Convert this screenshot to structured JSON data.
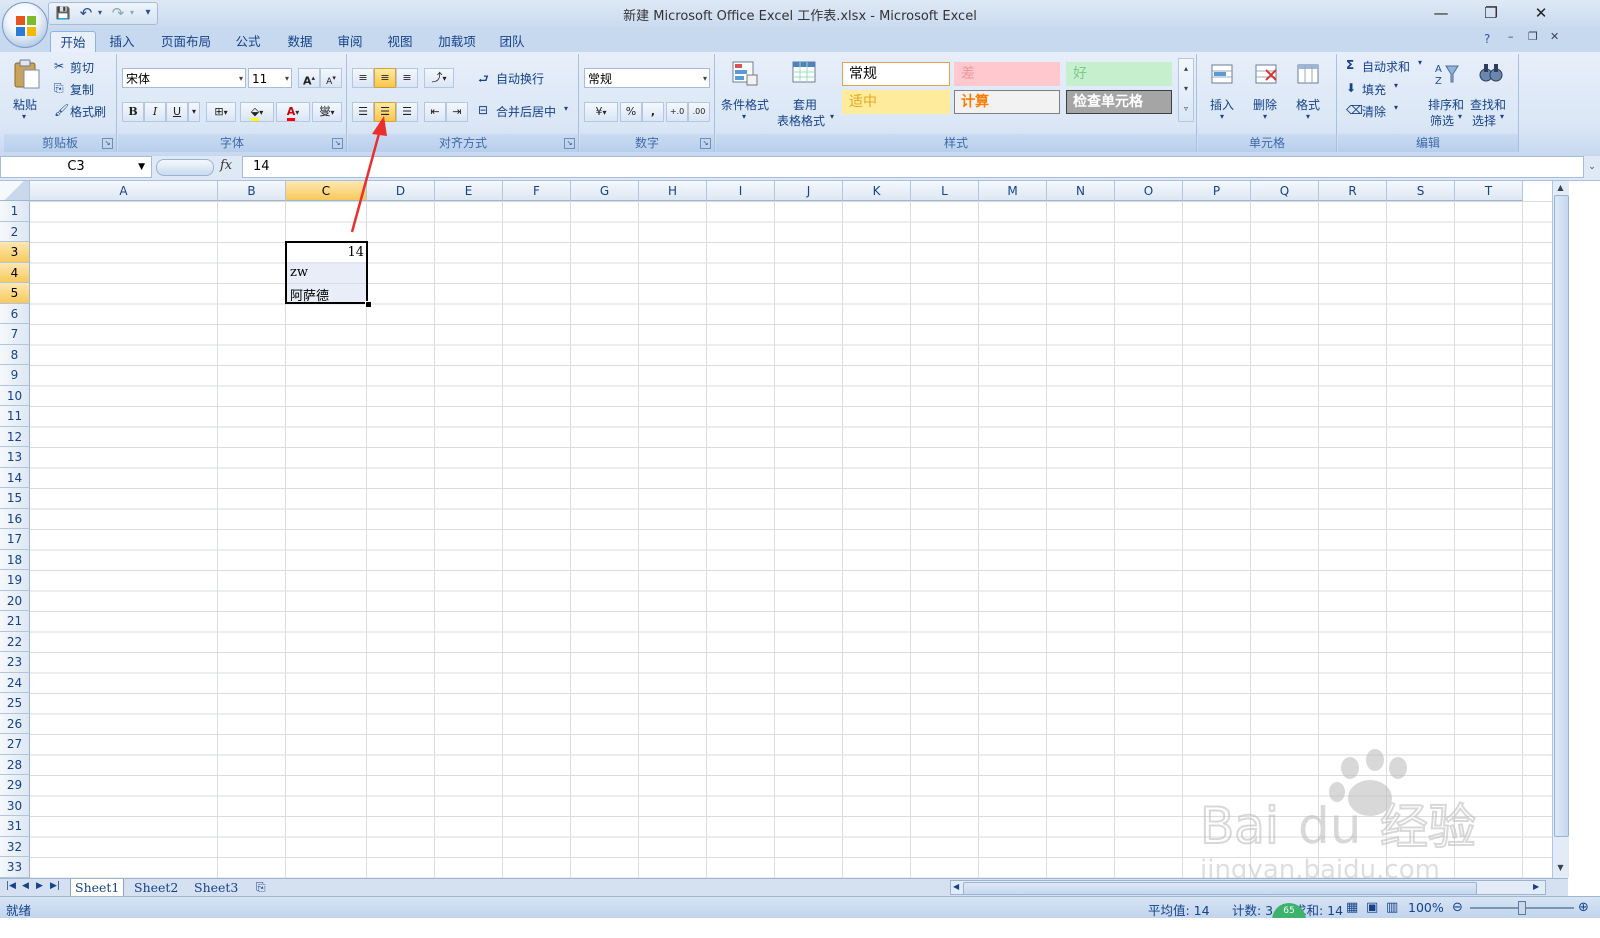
{
  "window": {
    "title": "新建 Microsoft Office Excel 工作表.xlsx - Microsoft Excel",
    "controls": [
      "—",
      "❐",
      "✕"
    ]
  },
  "quick_access": {
    "save": "💾",
    "undo": "↶",
    "redo": "↷",
    "customize": "▾"
  },
  "tabs": [
    "开始",
    "插入",
    "页面布局",
    "公式",
    "数据",
    "审阅",
    "视图",
    "加载项",
    "团队"
  ],
  "active_tab": "开始",
  "ribbon": {
    "clipboard": {
      "label": "剪贴板",
      "paste": "粘贴",
      "cut": "剪切",
      "copy": "复制",
      "format_painter": "格式刷"
    },
    "font": {
      "label": "字体",
      "font_name": "宋体",
      "font_size": "11",
      "grow": "A",
      "shrink": "A",
      "bold": "B",
      "italic": "I",
      "underline": "U",
      "phonetic": "燮"
    },
    "alignment": {
      "label": "对齐方式",
      "wrap_text": "自动换行",
      "merge_center": "合并后居中"
    },
    "number": {
      "label": "数字",
      "format": "常规",
      "currency": "¥",
      "percent": "%",
      "comma": ",",
      "inc_decimal": "+.0",
      "dec_decimal": ".00"
    },
    "styles": {
      "label": "样式",
      "conditional": "条件格式",
      "table_format_1": "套用",
      "table_format_2": "表格格式",
      "cells": [
        {
          "text": "常规",
          "bg": "#ffffff",
          "color": "#000000",
          "border": "#e8a050"
        },
        {
          "text": "差",
          "bg": "#ffc7ce",
          "color": "#ea9aa0",
          "border": "#ffc7ce"
        },
        {
          "text": "好",
          "bg": "#c6efce",
          "color": "#7fc98a",
          "border": "#c6efce"
        },
        {
          "text": "适中",
          "bg": "#ffeb9c",
          "color": "#e4a81b",
          "border": "#ffeb9c"
        },
        {
          "text": "计算",
          "bg": "#f2f2f2",
          "color": "#fa7d00",
          "border": "#7f7f7f"
        },
        {
          "text": "检查单元格",
          "bg": "#a5a5a5",
          "color": "#ffffff",
          "border": "#3f3f3f"
        }
      ]
    },
    "cells_group": {
      "label": "单元格",
      "insert": "插入",
      "delete": "删除",
      "format": "格式"
    },
    "editing": {
      "label": "编辑",
      "autosum": "自动求和",
      "fill": "填充",
      "clear": "清除",
      "sort_1": "排序和",
      "sort_2": "筛选",
      "find_1": "查找和",
      "find_2": "选择"
    }
  },
  "formula_bar": {
    "name_box": "C3",
    "fx": "fx",
    "value": "14"
  },
  "columns": [
    "A",
    "B",
    "C",
    "D",
    "E",
    "F",
    "G",
    "H",
    "I",
    "J",
    "K",
    "L",
    "M",
    "N",
    "O",
    "P",
    "Q",
    "R",
    "S",
    "T"
  ],
  "selected_column": "C",
  "rows": [
    "1",
    "2",
    "3",
    "4",
    "5",
    "6",
    "7",
    "8",
    "9",
    "10",
    "11",
    "12",
    "13",
    "14",
    "15",
    "16",
    "17",
    "18",
    "19",
    "20",
    "21",
    "22",
    "23",
    "24",
    "25",
    "26",
    "27",
    "28",
    "29",
    "30",
    "31",
    "32",
    "33"
  ],
  "selected_rows": [
    "3",
    "4",
    "5"
  ],
  "cells": {
    "C3": "14",
    "C4": "zw",
    "C5": "阿萨德"
  },
  "sheets": [
    "Sheet1",
    "Sheet2",
    "Sheet3"
  ],
  "active_sheet": "Sheet1",
  "status": {
    "ready": "就绪",
    "average": "平均值: 14",
    "count": "计数: 3",
    "sum": "求和: 14",
    "zoom": "100%",
    "badge": "65"
  },
  "watermark": {
    "brand": "Bai",
    "brand2": "du",
    "cn": "经验",
    "url": "jingyan.baidu.com"
  }
}
